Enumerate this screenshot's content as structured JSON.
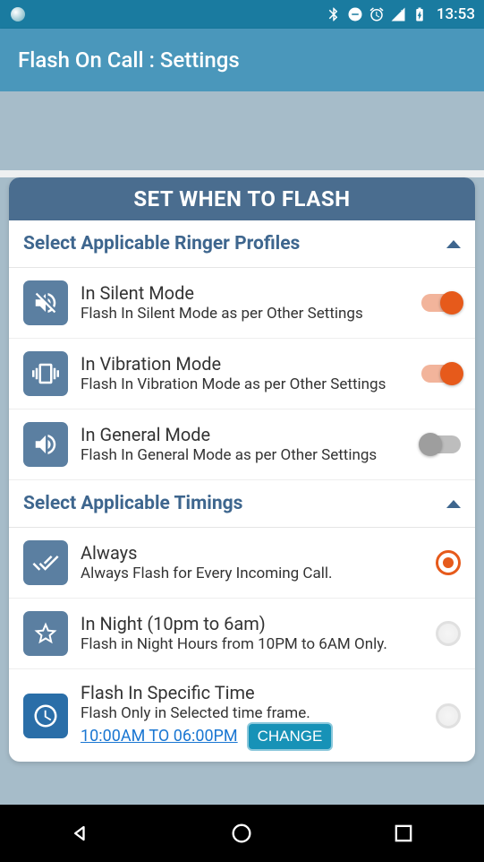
{
  "status": {
    "time": "13:53"
  },
  "app_title": "Flash On Call : Settings",
  "card_title": "SET WHEN TO FLASH",
  "sections": {
    "ringer": {
      "header": "Select Applicable Ringer Profiles",
      "items": [
        {
          "title": "In Silent Mode",
          "sub": "Flash In Silent Mode as per Other Settings",
          "on": true
        },
        {
          "title": "In Vibration Mode",
          "sub": "Flash In Vibration Mode as per Other Settings",
          "on": true
        },
        {
          "title": "In General Mode",
          "sub": "Flash In General Mode as per Other Settings",
          "on": false
        }
      ]
    },
    "timings": {
      "header": "Select Applicable Timings",
      "items": [
        {
          "title": "Always",
          "sub": "Always Flash for Every Incoming Call.",
          "selected": true
        },
        {
          "title": "In Night (10pm to 6am)",
          "sub": "Flash in Night Hours from 10PM to 6AM Only.",
          "selected": false
        },
        {
          "title": "Flash In Specific Time",
          "sub": "Flash Only in Selected time frame.",
          "selected": false,
          "time_range": "10:00AM TO 06:00PM",
          "change_label": "CHANGE"
        }
      ]
    }
  }
}
